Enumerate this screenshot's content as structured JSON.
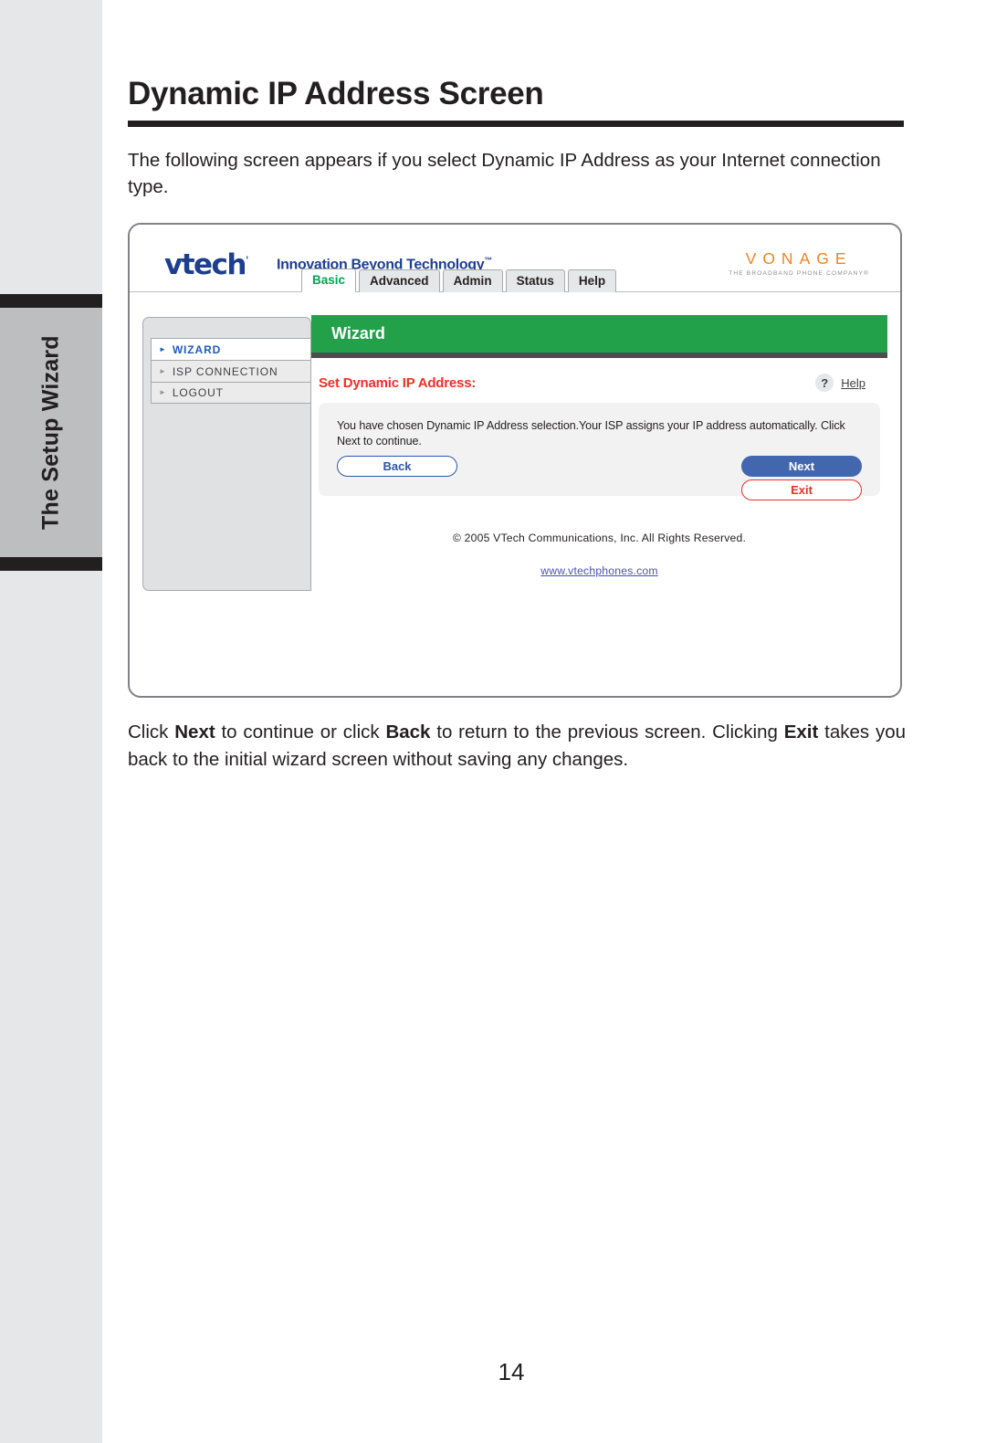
{
  "page": {
    "title": "Dynamic IP Address Screen",
    "intro": "The following screen appears if you select Dynamic IP Address as your Internet connection type.",
    "side_tab_label": "The Setup Wizard",
    "page_number": "14"
  },
  "screenshot": {
    "brand": {
      "vtech_logo": "vtech",
      "vtech_logo_tm": "'",
      "tagline": "Innovation Beyond Technology",
      "tagline_tm": "™",
      "vonage_word": "VONAGE",
      "vonage_sub": "THE BROADBAND PHONE COMPANY®"
    },
    "tabs": [
      {
        "label": "Basic",
        "active": true
      },
      {
        "label": "Advanced",
        "active": false
      },
      {
        "label": "Admin",
        "active": false
      },
      {
        "label": "Status",
        "active": false
      },
      {
        "label": "Help",
        "active": false
      }
    ],
    "sidebar": [
      {
        "label": "WIZARD",
        "active": true
      },
      {
        "label": "ISP CONNECTION",
        "active": false
      },
      {
        "label": "LOGOUT",
        "active": false
      }
    ],
    "banner_title": "Wizard",
    "section_title": "Set Dynamic IP Address:",
    "help_qmark": "?",
    "help_label": "Help",
    "info_text": "You have chosen Dynamic IP Address selection.Your ISP assigns your IP address automatically. Click Next to continue.",
    "buttons": {
      "back": "Back",
      "next": "Next",
      "exit": "Exit"
    },
    "footer": {
      "copyright": "© 2005 VTech Communications, Inc. All Rights Reserved.",
      "link": "www.vtechphones.com"
    },
    "colors": {
      "banner_green": "#22a14a",
      "section_red": "#ed3024",
      "vtech_blue": "#1e3f8f",
      "vonage_orange": "#f58220",
      "next_blue": "#4267ae"
    }
  },
  "outro": {
    "seg1": "Click ",
    "b1": "Next",
    "seg2": " to continue or click ",
    "b2": "Back",
    "seg3": " to return to the previous screen. Clicking ",
    "b3": "Exit",
    "seg4": " takes you back to the initial wizard screen without saving any changes."
  }
}
